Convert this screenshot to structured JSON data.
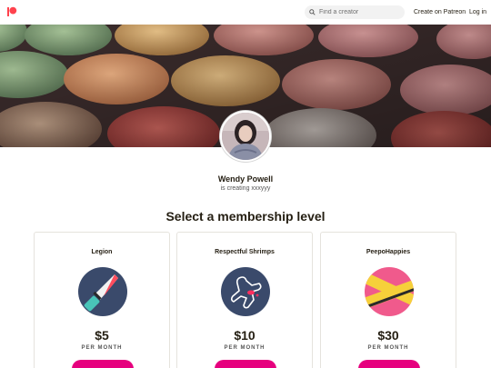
{
  "header": {
    "logo_icon": "patreon-logo-icon",
    "search_placeholder": "Find a creator",
    "create_label": "Create on Patreon",
    "login_label": "Log in"
  },
  "creator": {
    "name": "Wendy Powell",
    "tagline": "is creating xxxyyy"
  },
  "section_title": "Select a membership level",
  "tiers": [
    {
      "name": "Legion",
      "price": "$5",
      "period": "PER MONTH",
      "icon": "knife-icon"
    },
    {
      "name": "Respectful Shrimps",
      "price": "$10",
      "period": "PER MONTH",
      "icon": "chalk-outline-icon"
    },
    {
      "name": "PeepoHappies",
      "price": "$30",
      "period": "PER MONTH",
      "icon": "crime-scene-tape-icon"
    }
  ],
  "colors": {
    "brand": "#ff424d",
    "button": "#e6007e",
    "text": "#241e12"
  }
}
